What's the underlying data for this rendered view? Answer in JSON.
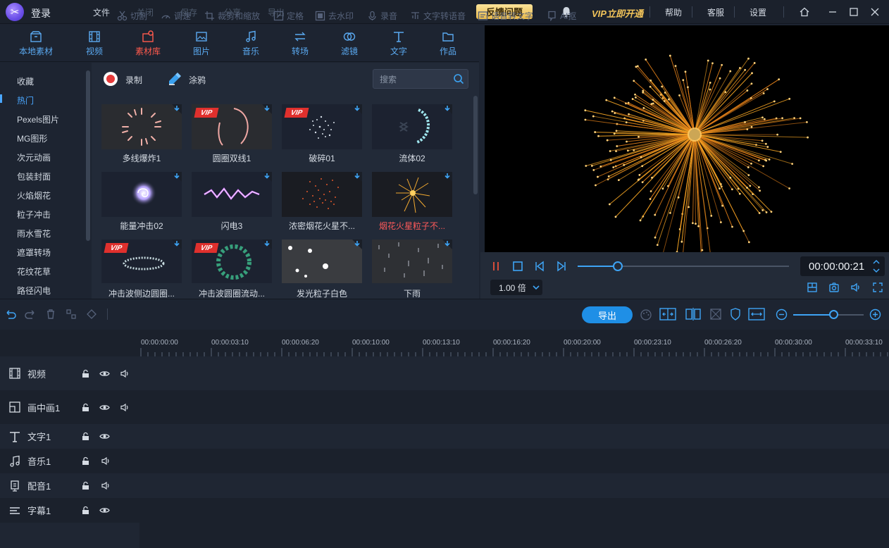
{
  "titlebar": {
    "login": "登录",
    "menus": [
      {
        "label": "文件",
        "enabled": true
      },
      {
        "label": "关闭",
        "enabled": false
      },
      {
        "label": "保存",
        "enabled": false
      },
      {
        "label": "分享",
        "enabled": false
      },
      {
        "label": "导出",
        "enabled": false
      }
    ],
    "feedback": "反馈问题",
    "vip": "VIP立即开通",
    "help": "帮助",
    "service": "客服",
    "settings": "设置"
  },
  "tools": [
    {
      "label": "本地素材",
      "icon": "box-icon"
    },
    {
      "label": "视频",
      "icon": "film-icon"
    },
    {
      "label": "素材库",
      "icon": "material-icon",
      "active": true
    },
    {
      "label": "图片",
      "icon": "image-icon"
    },
    {
      "label": "音乐",
      "icon": "music-icon"
    },
    {
      "label": "转场",
      "icon": "transition-icon"
    },
    {
      "label": "滤镜",
      "icon": "filter-icon"
    },
    {
      "label": "文字",
      "icon": "text-icon"
    },
    {
      "label": "作品",
      "icon": "folder-icon"
    }
  ],
  "categories": [
    "收藏",
    "热门",
    "Pexels图片",
    "MG图形",
    "次元动画",
    "包装封面",
    "火焰烟花",
    "粒子冲击",
    "雨水雪花",
    "遮罩转场",
    "花纹花草",
    "路径闪电"
  ],
  "active_category": "热门",
  "content": {
    "record": "录制",
    "doodle": "涂鸦",
    "search_placeholder": "搜索",
    "items": [
      {
        "label": "多线爆炸1",
        "vip": false
      },
      {
        "label": "圆圈双线1",
        "vip": true
      },
      {
        "label": "破碎01",
        "vip": true
      },
      {
        "label": "流体02",
        "vip": false
      },
      {
        "label": "能量冲击02",
        "vip": false
      },
      {
        "label": "闪电3",
        "vip": false
      },
      {
        "label": "浓密烟花火星不...",
        "vip": false
      },
      {
        "label": "烟花火星粒子不...",
        "vip": false,
        "selected": true
      },
      {
        "label": "冲击波侧边圆圈...",
        "vip": true
      },
      {
        "label": "冲击波圆圈流动...",
        "vip": true
      },
      {
        "label": "发光粒子白色",
        "vip": false
      },
      {
        "label": "下雨",
        "vip": false
      }
    ],
    "vip_badge": "VIP"
  },
  "player": {
    "timecode": "00:00:00:21",
    "speed": "1.00 倍",
    "progress": 0.19
  },
  "edit_toolbar": {
    "items": [
      "切割",
      "调速",
      "裁剪和缩放",
      "定格",
      "去水印",
      "录音",
      "文字转语音",
      "语音转文字",
      "AI抠"
    ],
    "export": "导出",
    "zoom": 0.57
  },
  "ruler": [
    "00:00:00:00",
    "00:00:03:10",
    "00:00:06:20",
    "00:00:10:00",
    "00:00:13:10",
    "00:00:16:20",
    "00:00:20:00",
    "00:00:23:10",
    "00:00:26:20",
    "00:00:30:00",
    "00:00:33:10"
  ],
  "tracks": [
    {
      "name": "视频",
      "icon": "film-icon",
      "controls": [
        "lock",
        "eye",
        "volume"
      ]
    },
    {
      "name": "画中画1",
      "icon": "pip-icon",
      "controls": [
        "lock",
        "eye",
        "volume"
      ]
    },
    {
      "name": "文字1",
      "icon": "text-icon",
      "controls": [
        "lock",
        "eye"
      ]
    },
    {
      "name": "音乐1",
      "icon": "music-icon",
      "controls": [
        "lock",
        "volume"
      ]
    },
    {
      "name": "配音1",
      "icon": "mic-icon",
      "controls": [
        "lock",
        "volume"
      ]
    },
    {
      "name": "字幕1",
      "icon": "subtitle-icon",
      "controls": [
        "lock",
        "eye"
      ]
    }
  ]
}
